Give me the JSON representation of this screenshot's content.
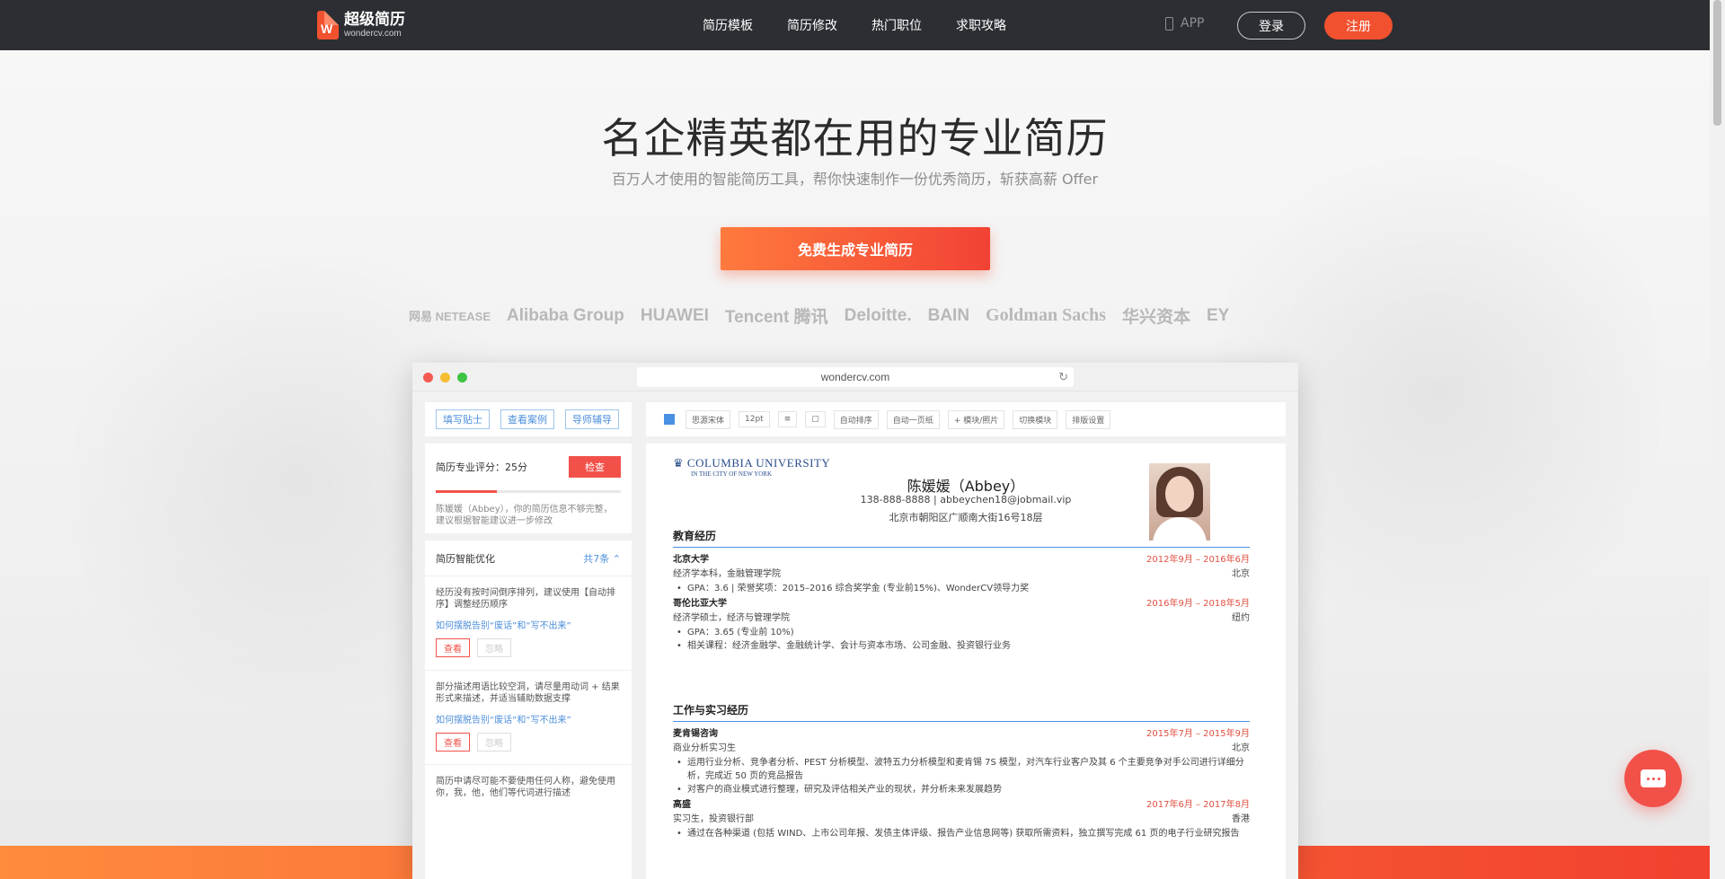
{
  "nav": {
    "logo_cn": "超级简历",
    "logo_en": "wondercv.com",
    "links": [
      "简历模板",
      "简历修改",
      "热门职位",
      "求职攻略"
    ],
    "app_label": "APP",
    "login": "登录",
    "register": "注册"
  },
  "hero": {
    "title": "名企精英都在用的专业简历",
    "subtitle": "百万人才使用的智能简历工具，帮你快速制作一份优秀简历，斩获高薪 Offer",
    "cta": "免费生成专业简历"
  },
  "corporate_logos": [
    "网易 NETEASE",
    "Alibaba Group",
    "HUAWEI",
    "Tencent 腾讯",
    "Deloitte.",
    "BAIN",
    "Goldman Sachs",
    "华兴资本",
    "EY"
  ],
  "browser": {
    "url": "wondercv.com"
  },
  "left_panel": {
    "tabs": [
      "填写贴士",
      "查看案例",
      "导师辅导"
    ],
    "score_label": "简历专业评分：25分",
    "check_button": "检查",
    "score_fraction": 0.25,
    "score_note": "陈媛媛（Abbey），你的简历信息不够完整，建议根据智能建议进一步修改",
    "opt_title": "简历智能优化",
    "opt_count": "共7条",
    "items": [
      {
        "text": "经历没有按时间倒序排列，建议使用【自动排序】调整经历顺序",
        "link": "如何摆脱告别“废话”和“写不出来”",
        "view": "查看",
        "ignore": "忽略"
      },
      {
        "text": "部分描述用语比较空洞，请尽量用动词 + 结果形式来描述，并适当辅助数据支撑",
        "link": "如何摆脱告别“废话”和“写不出来”",
        "view": "查看",
        "ignore": "忽略"
      },
      {
        "text": "简历中请尽可能不要使用任何人称，避免使用你，我，他，他们等代词进行描述",
        "link": "",
        "view": "",
        "ignore": ""
      }
    ]
  },
  "toolbar": {
    "items": [
      "思源宋体",
      "12pt",
      "≡",
      "▢",
      "自动排序",
      "自动一页纸",
      "+ 模块/照片",
      "切换模块",
      "排版设置"
    ]
  },
  "resume": {
    "school_logo": "COLUMBIA UNIVERSITY",
    "school_logo_sub": "IN THE CITY OF NEW YORK",
    "name": "陈媛媛（Abbey）",
    "contact": "138-888-8888 | abbeychen18@jobmail.vip",
    "address": "北京市朝阳区广顺南大街16号18层",
    "education_title": "教育经历",
    "education": [
      {
        "org": "北京大学",
        "date": "2012年9月 – 2016年6月",
        "sub": "经济学本科，金融管理学院",
        "loc": "北京",
        "bullets": [
          "GPA：3.6 | 荣誉奖项：2015–2016 综合奖学金 (专业前15%)、WonderCV领导力奖"
        ]
      },
      {
        "org": "哥伦比亚大学",
        "date": "2016年9月 – 2018年5月",
        "sub": "经济学硕士，经济与管理学院",
        "loc": "纽约",
        "bullets": [
          "GPA：3.65 (专业前 10%)",
          "相关课程：经济金融学、金融统计学、会计与资本市场、公司金融、投资银行业务"
        ]
      }
    ],
    "work_title": "工作与实习经历",
    "work": [
      {
        "org": "麦肯锡咨询",
        "date": "2015年7月 – 2015年9月",
        "sub": "商业分析实习生",
        "loc": "北京",
        "bullets": [
          "运用行业分析、竞争者分析、PEST 分析模型、波特五力分析模型和麦肯锡 7S 模型，对汽车行业客户及其 6 个主要竞争对手公司进行详细分析，完成近 50 页的竞品报告",
          "对客户的商业模式进行整理，研究及评估相关产业的现状，并分析未来发展趋势"
        ]
      },
      {
        "org": "高盛",
        "date": "2017年6月 – 2017年8月",
        "sub": "实习生，投资银行部",
        "loc": "香港",
        "bullets": [
          "通过在各种渠道 (包括 WIND、上市公司年报、发债主体评级、报告产业信息网等) 获取所需资料，独立撰写完成 61 页的电子行业研究报告"
        ]
      }
    ]
  },
  "colors": {
    "nav_bg": "#2c2e33",
    "accent": "#f2512f",
    "link_blue": "#4d8fdb"
  }
}
